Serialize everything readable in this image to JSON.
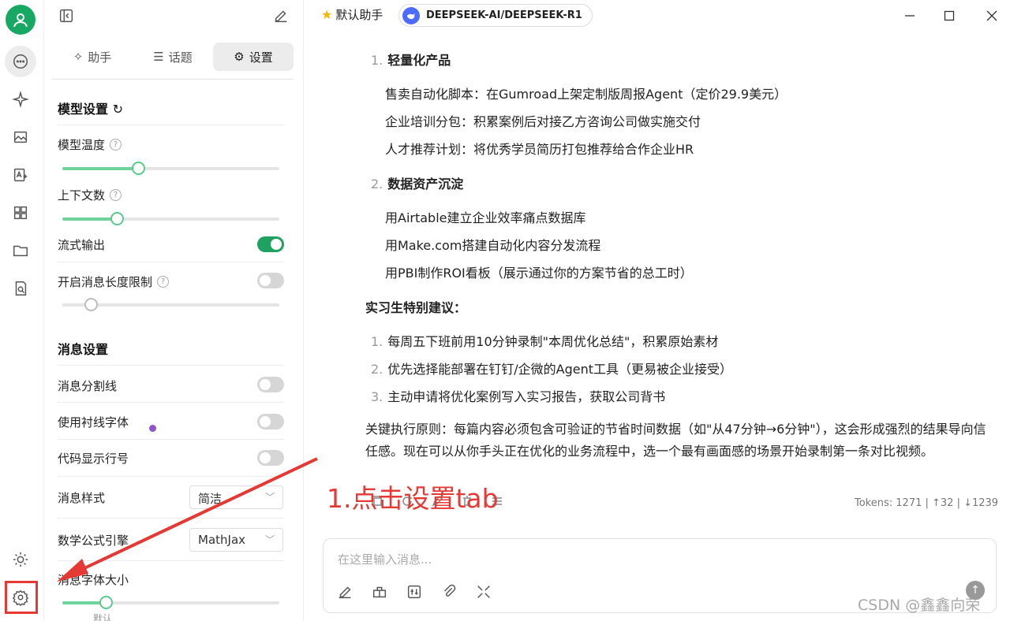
{
  "rail": {
    "items": [
      "avatar",
      "chat",
      "agents",
      "images",
      "translate",
      "apps",
      "files",
      "knowledge"
    ],
    "bottom": [
      "theme",
      "settings"
    ]
  },
  "panel": {
    "tabs": [
      {
        "label": "助手",
        "icon": "sparkle-icon"
      },
      {
        "label": "话题",
        "icon": "list-icon"
      },
      {
        "label": "设置",
        "icon": "gear-icon"
      }
    ],
    "model_section": "模型设置",
    "temperature_label": "模型温度",
    "temperature_value": 0.35,
    "context_label": "上下文数",
    "context_value": 0.25,
    "stream_label": "流式输出",
    "stream_on": true,
    "max_length_label": "开启消息长度限制",
    "max_length_on": false,
    "max_length_value": 0.13,
    "message_section": "消息设置",
    "divider_label": "消息分割线",
    "serif_label": "使用衬线字体",
    "line_numbers_label": "代码显示行号",
    "style_label": "消息样式",
    "style_value": "简洁",
    "math_label": "数学公式引擎",
    "math_value": "MathJax",
    "font_size_label": "消息字体大小",
    "font_size_value": 0.2,
    "font_size_hint": "默认"
  },
  "topbar": {
    "assistant": "默认助手",
    "model": "DEEPSEEK-AI/DEEPSEEK-R1"
  },
  "message": {
    "h1": "轻量化产品",
    "h1_items": [
      "售卖自动化脚本：在Gumroad上架定制版周报Agent（定价29.9美元）",
      "企业培训分包：积累案例后对接乙方咨询公司做实施交付",
      "人才推荐计划：将优秀学员简历打包推荐给合作企业HR"
    ],
    "h2": "数据资产沉淀",
    "h2_items": [
      "用Airtable建立企业效率痛点数据库",
      "用Make.com搭建自动化内容分发流程",
      "用PBI制作ROI看板（展示通过你的方案节省的总工时）"
    ],
    "h3": "实习生特别建议：",
    "h3_items": [
      "每周五下班前用10分钟录制\"本周优化总结\"，积累原始素材",
      "优先选择能部署在钉钉/企微的Agent工具（更易被企业接受）",
      "主动申请将优化案例写入实习报告，获取公司背书"
    ],
    "conclusion": "关键执行原则：每篇内容必须包含可验证的节省时间数据（如\"从47分钟→6分钟\"），这会形成强烈的结果导向信任感。现在可以从你手头正在优化的业务流程中，选一个最有画面感的场景开始录制第一条对比视频。",
    "tokens": "Tokens: 1271 | ↑32 | ↓1239"
  },
  "input": {
    "placeholder": "在这里输入消息..."
  },
  "annotation": "1.点击设置tab",
  "watermark": "CSDN @鑫鑫向荣",
  "colors": {
    "accent": "#20a162",
    "annotation": "#e53935",
    "avatar": "#17a964"
  }
}
